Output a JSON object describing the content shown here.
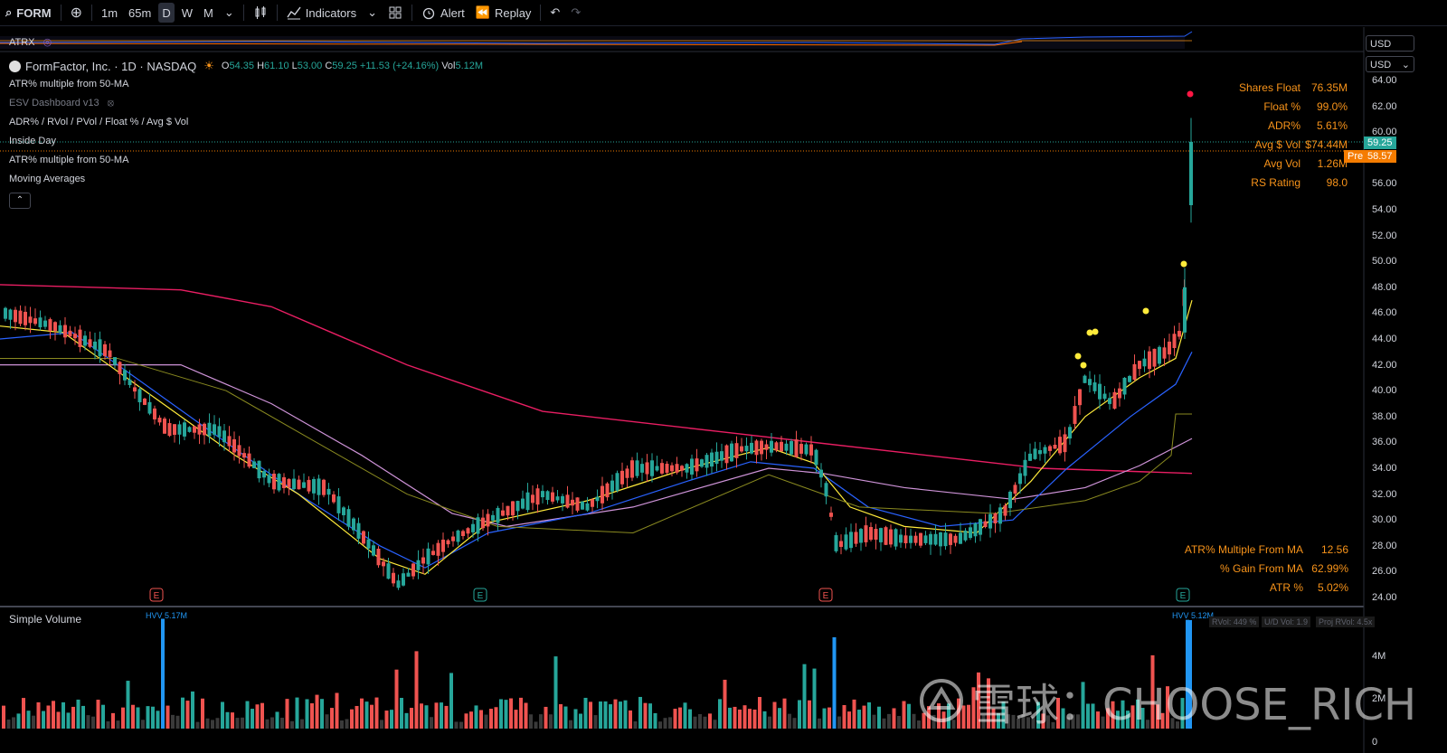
{
  "toolbar": {
    "symbol": "FORM",
    "intervals": [
      "1m",
      "65m",
      "D",
      "W",
      "M"
    ],
    "active_interval": "D",
    "indicators_label": "Indicators",
    "alert_label": "Alert",
    "replay_label": "Replay"
  },
  "atrx_pane": {
    "label": "ATRX",
    "currency": "USD"
  },
  "legend": {
    "title": "FormFactor, Inc. · 1D · NASDAQ",
    "ohlc": {
      "o_label": "O",
      "o": "54.35",
      "h_label": "H",
      "h": "61.10",
      "l_label": "L",
      "l": "53.00",
      "c_label": "C",
      "c": "59.25",
      "change": "+11.53 (+24.16%)",
      "vol_label": "Vol",
      "vol": "5.12M"
    },
    "indicators": [
      "ATR% multiple from 50-MA",
      "ESV Dashboard v13",
      "ADR% / RVol / PVol / Float % / Avg $ Vol",
      "Inside Day",
      "ATR% multiple from 50-MA",
      "Moving Averages"
    ]
  },
  "stats_top": [
    {
      "k": "Shares Float",
      "v": "76.35M"
    },
    {
      "k": "Float %",
      "v": "99.0%"
    },
    {
      "k": "ADR%",
      "v": "5.61%"
    },
    {
      "k": "Avg $ Vol",
      "v": "$74.44M"
    },
    {
      "k": "Avg Vol",
      "v": "1.26M"
    },
    {
      "k": "RS Rating",
      "v": "98.0"
    }
  ],
  "stats_bottom": [
    {
      "k": "ATR% Multiple From MA",
      "v": "12.56"
    },
    {
      "k": "% Gain From MA",
      "v": "62.99%"
    },
    {
      "k": "ATR %",
      "v": "5.02%"
    }
  ],
  "price_axis": {
    "currency": "USD",
    "ticks": [
      "64.00",
      "62.00",
      "60.00",
      "58.00",
      "56.00",
      "54.00",
      "52.00",
      "50.00",
      "48.00",
      "46.00",
      "44.00",
      "42.00",
      "40.00",
      "38.00",
      "36.00",
      "34.00",
      "32.00",
      "30.00",
      "28.00",
      "26.00",
      "24.00"
    ],
    "last_price": "59.25",
    "pre_label": "Pre",
    "pre_price": "58.57"
  },
  "volume_pane": {
    "label": "Simple Volume",
    "hvv_left": "HVV 5.17M",
    "hvv_right": "HVV 5.12M",
    "stats": [
      "RVol: 449 %",
      "U/D Vol: 1.9",
      "Proj RVol: 4.5x"
    ],
    "ticks": [
      "4M",
      "2M",
      "0"
    ]
  },
  "watermark": {
    "text": "雪球：CHOOSE_RICH"
  },
  "colors": {
    "up": "#26a69a",
    "down": "#ef5350",
    "vol_blue": "#2196f3",
    "ma200": "#e91e63",
    "ma50": "#ce93d8",
    "ma21": "#2962ff",
    "ma10": "#ffeb3b",
    "stats": "#f7931a"
  }
}
